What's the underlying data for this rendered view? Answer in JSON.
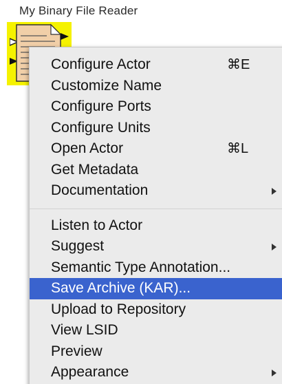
{
  "actor": {
    "title": "My Binary File Reader",
    "icon": "document-icon",
    "highlight_color": "#f5f200"
  },
  "menu": {
    "selected_color": "#3a63ce",
    "items": [
      {
        "label": "Configure Actor",
        "shortcut": "⌘E",
        "submenu": false
      },
      {
        "label": "Customize Name",
        "shortcut": "",
        "submenu": false
      },
      {
        "label": "Configure Ports",
        "shortcut": "",
        "submenu": false
      },
      {
        "label": "Configure Units",
        "shortcut": "",
        "submenu": false
      },
      {
        "label": "Open Actor",
        "shortcut": "⌘L",
        "submenu": false
      },
      {
        "label": "Get Metadata",
        "shortcut": "",
        "submenu": false
      },
      {
        "label": "Documentation",
        "shortcut": "",
        "submenu": true
      },
      {
        "label": "Listen to Actor",
        "shortcut": "",
        "submenu": false
      },
      {
        "label": "Suggest",
        "shortcut": "",
        "submenu": true
      },
      {
        "label": "Semantic Type Annotation...",
        "shortcut": "",
        "submenu": false
      },
      {
        "label": "Save Archive (KAR)...",
        "shortcut": "",
        "submenu": false,
        "selected": true
      },
      {
        "label": "Upload to Repository",
        "shortcut": "",
        "submenu": false
      },
      {
        "label": "View LSID",
        "shortcut": "",
        "submenu": false
      },
      {
        "label": "Preview",
        "shortcut": "",
        "submenu": false
      },
      {
        "label": "Appearance",
        "shortcut": "",
        "submenu": true
      }
    ]
  }
}
